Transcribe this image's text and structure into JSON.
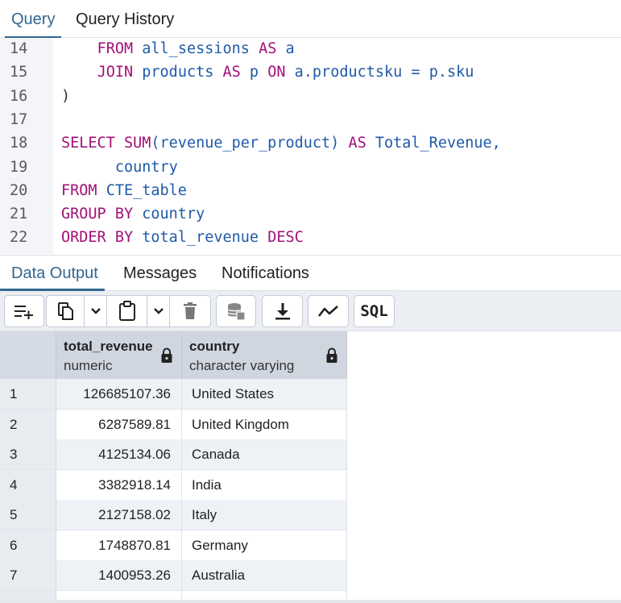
{
  "top_tabs": [
    {
      "label": "Query"
    },
    {
      "label": "Query History"
    }
  ],
  "editor": {
    "lines": [
      {
        "num": "14",
        "tokens": [
          {
            "t": "    ",
            "c": "pl"
          },
          {
            "t": "FROM",
            "c": "kw"
          },
          {
            "t": " ",
            "c": "pl"
          },
          {
            "t": "all_sessions",
            "c": "id"
          },
          {
            "t": " ",
            "c": "pl"
          },
          {
            "t": "AS",
            "c": "kw"
          },
          {
            "t": " a",
            "c": "id"
          }
        ]
      },
      {
        "num": "15",
        "tokens": [
          {
            "t": "    ",
            "c": "pl"
          },
          {
            "t": "JOIN",
            "c": "kw"
          },
          {
            "t": " ",
            "c": "pl"
          },
          {
            "t": "products",
            "c": "id"
          },
          {
            "t": " ",
            "c": "pl"
          },
          {
            "t": "AS",
            "c": "kw"
          },
          {
            "t": " p ",
            "c": "id"
          },
          {
            "t": "ON",
            "c": "kw"
          },
          {
            "t": " a.productsku = p.sku",
            "c": "id"
          }
        ]
      },
      {
        "num": "16",
        "tokens": [
          {
            "t": ")",
            "c": "pl"
          }
        ]
      },
      {
        "num": "17",
        "tokens": []
      },
      {
        "num": "18",
        "tokens": [
          {
            "t": "SELECT",
            "c": "kw"
          },
          {
            "t": " ",
            "c": "pl"
          },
          {
            "t": "SUM",
            "c": "kw"
          },
          {
            "t": "(revenue_per_product) ",
            "c": "id"
          },
          {
            "t": "AS",
            "c": "kw"
          },
          {
            "t": " Total_Revenue,",
            "c": "id"
          }
        ]
      },
      {
        "num": "19",
        "tokens": [
          {
            "t": "      ",
            "c": "pl"
          },
          {
            "t": "country",
            "c": "id"
          }
        ]
      },
      {
        "num": "20",
        "tokens": [
          {
            "t": "FROM",
            "c": "kw"
          },
          {
            "t": " CTE_table",
            "c": "id"
          }
        ]
      },
      {
        "num": "21",
        "tokens": [
          {
            "t": "GROUP BY",
            "c": "kw"
          },
          {
            "t": " country",
            "c": "id"
          }
        ]
      },
      {
        "num": "22",
        "tokens": [
          {
            "t": "ORDER BY",
            "c": "kw"
          },
          {
            "t": " total_revenue ",
            "c": "id"
          },
          {
            "t": "DESC",
            "c": "kw"
          }
        ]
      }
    ]
  },
  "output_tabs": [
    {
      "label": "Data Output"
    },
    {
      "label": "Messages"
    },
    {
      "label": "Notifications"
    }
  ],
  "toolbar": {
    "sql_label": "SQL"
  },
  "grid": {
    "columns": [
      {
        "name": "total_revenue",
        "type": "numeric"
      },
      {
        "name": "country",
        "type": "character varying"
      }
    ],
    "rows": [
      {
        "n": "1",
        "revenue": "126685107.36",
        "country": "United States"
      },
      {
        "n": "2",
        "revenue": "6287589.81",
        "country": "United Kingdom"
      },
      {
        "n": "3",
        "revenue": "4125134.06",
        "country": "Canada"
      },
      {
        "n": "4",
        "revenue": "3382918.14",
        "country": "India"
      },
      {
        "n": "5",
        "revenue": "2127158.02",
        "country": "Italy"
      },
      {
        "n": "6",
        "revenue": "1748870.81",
        "country": "Germany"
      },
      {
        "n": "7",
        "revenue": "1400953.26",
        "country": "Australia"
      }
    ]
  },
  "colors": {
    "accent": "#326690",
    "keyword": "#a21078",
    "identifier": "#1f5aa8"
  }
}
